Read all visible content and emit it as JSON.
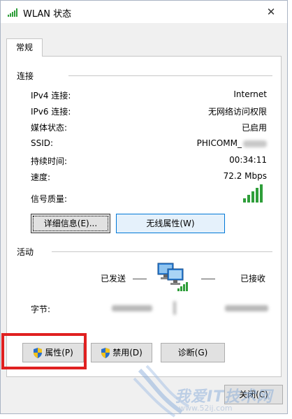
{
  "window": {
    "title": "WLAN 状态",
    "close_glyph": "✕"
  },
  "tabs": [
    {
      "label": "常规"
    }
  ],
  "connection": {
    "section_label": "连接",
    "rows": [
      {
        "label": "IPv4 连接:",
        "value": "Internet"
      },
      {
        "label": "IPv6 连接:",
        "value": "无网络访问权限"
      },
      {
        "label": "媒体状态:",
        "value": "已启用"
      },
      {
        "label": "SSID:",
        "value": "PHICOMM_"
      },
      {
        "label": "持续时间:",
        "value": "00:34:11"
      },
      {
        "label": "速度:",
        "value": "72.2 Mbps"
      },
      {
        "label": "信号质量:",
        "value": ""
      }
    ],
    "signal_bars": 5
  },
  "buttons_top": {
    "details": "详细信息(E)...",
    "wireless_props": "无线属性(W)"
  },
  "activity": {
    "section_label": "活动",
    "sent_label": "已发送",
    "received_label": "已接收",
    "bytes_label": "字节:"
  },
  "buttons_bottom": {
    "properties": "属性(P)",
    "disable": "禁用(D)",
    "diagnose": "诊断(G)",
    "close": "关闭(C)"
  },
  "watermark": {
    "text": "我爱IT技术网",
    "sub": "www.52ij.com"
  },
  "colors": {
    "signal_green": "#2f9e3a",
    "highlight_red": "#e02020",
    "hover_blue": "#e5f1fb"
  }
}
